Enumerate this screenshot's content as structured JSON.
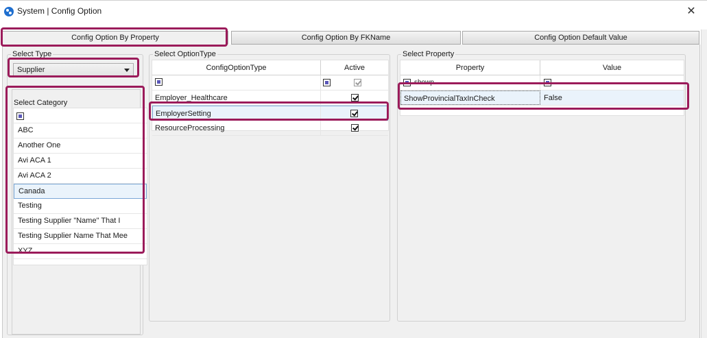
{
  "window": {
    "title": "System | Config Option",
    "close_symbol": "✕",
    "icon": "app-logo-icon"
  },
  "tabs": [
    {
      "label": "Config Option By Property",
      "active": true
    },
    {
      "label": "Config Option By FKName",
      "active": false
    },
    {
      "label": "Config Option Default Value",
      "active": false
    }
  ],
  "select_type": {
    "label": "Select Type",
    "value": "Supplier"
  },
  "select_category": {
    "label": "Select Category",
    "items": [
      "ABC",
      "Another One",
      "Avi ACA 1",
      "Avi ACA 2",
      "Canada",
      "Testing",
      "Testing Supplier \"Name\" That I",
      "Testing Supplier Name That Mee",
      "XYZ"
    ],
    "selected": "Canada"
  },
  "select_option_type": {
    "label": "Select OptionType",
    "columns": [
      "ConfigOptionType",
      "Active"
    ],
    "rows": [
      {
        "name": "Employer_Healthcare",
        "active": true
      },
      {
        "name": "EmployerSetting",
        "active": true,
        "selected": true
      },
      {
        "name": "ResourceProcessing",
        "active": true
      }
    ]
  },
  "select_property": {
    "label": "Select Property",
    "columns": [
      "Property",
      "Value"
    ],
    "filter_text": "showp",
    "rows": [
      {
        "property": "ShowProvincialTaxInCheck",
        "value": "False"
      }
    ]
  },
  "colors": {
    "highlight": "#9b1b5a",
    "selection": "#eaf3fb",
    "panel_bg": "#f0f0f0"
  }
}
